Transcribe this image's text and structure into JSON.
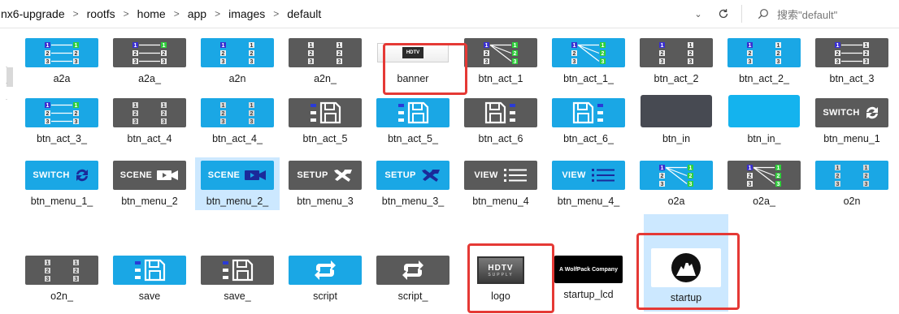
{
  "address_bar": {
    "crumbs": [
      "nx6-upgrade",
      "rootfs",
      "home",
      "app",
      "images",
      "default"
    ],
    "separator": ">"
  },
  "search": {
    "placeholder": "搜索\"default\""
  },
  "thumb_text": {
    "switch": "SWITCH",
    "scene": "SCENE",
    "setup": "SETUP",
    "view": "VIEW",
    "hdtv": "HDTV",
    "supply": "SUPPLY",
    "wolfpack": "A WolfPack Company"
  },
  "files": {
    "row1": [
      "a2a",
      "a2a_",
      "a2n",
      "a2n_",
      "banner",
      "btn_act_1",
      "btn_act_1_",
      "btn_act_2",
      "btn_act_2_",
      "btn_act_3"
    ],
    "row2": [
      "btn_act_3_",
      "btn_act_4",
      "btn_act_4_",
      "btn_act_5",
      "btn_act_5_",
      "btn_act_6",
      "btn_act_6_",
      "btn_in",
      "btn_in_",
      "btn_menu_1"
    ],
    "row3": [
      "btn_menu_1_",
      "btn_menu_2",
      "btn_menu_2_",
      "btn_menu_3",
      "btn_menu_3_",
      "btn_menu_4",
      "btn_menu_4_",
      "o2a",
      "o2a_",
      "o2n"
    ],
    "row4": [
      "o2n_",
      "save",
      "save_",
      "script",
      "script_",
      "logo",
      "startup_lcd",
      "startup"
    ]
  },
  "colors": {
    "blue_thumb": "#1aa7e5",
    "gray_thumb": "#5a5a5a",
    "highlight_box": "#e53935",
    "selection": "#cce8ff"
  }
}
